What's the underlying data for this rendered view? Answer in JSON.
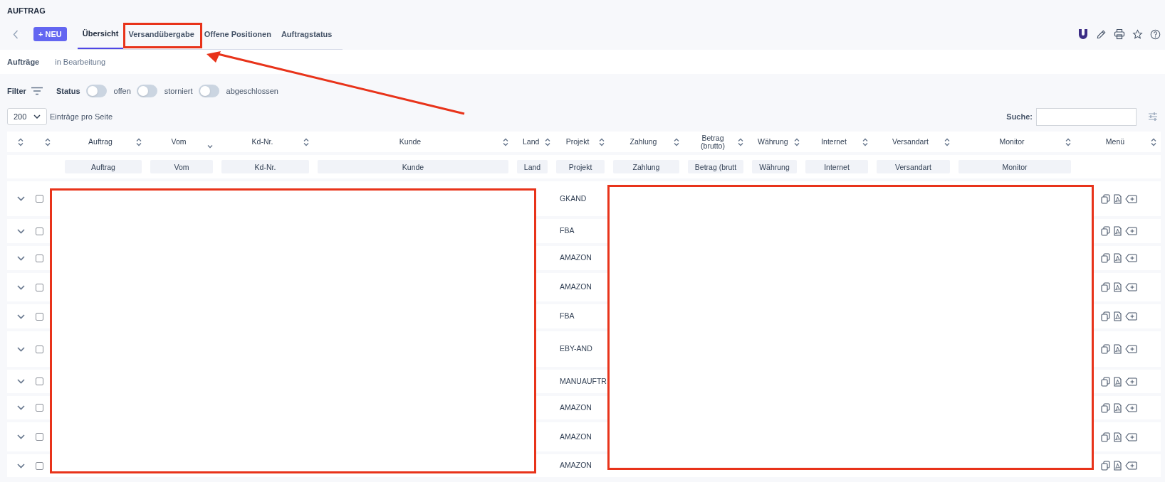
{
  "page_title": "AUFTRAG",
  "new_button": "+ NEU",
  "tabs": [
    {
      "label": "Übersicht",
      "selected": true
    },
    {
      "label": "Versandübergabe",
      "selected": false
    },
    {
      "label": "Offene Positionen",
      "selected": false
    },
    {
      "label": "Auftragstatus",
      "selected": false
    }
  ],
  "subnav": [
    {
      "label": "Aufträge",
      "selected": true
    },
    {
      "label": "in Bearbeitung",
      "selected": false
    }
  ],
  "filter": {
    "label": "Filter",
    "status_label": "Status",
    "toggles": [
      {
        "label": "offen",
        "on": false
      },
      {
        "label": "storniert",
        "on": false
      },
      {
        "label": "abgeschlossen",
        "on": false
      }
    ]
  },
  "page_size": {
    "value": "200",
    "label": "Einträge pro Seite"
  },
  "search": {
    "label": "Suche:"
  },
  "table": {
    "columns": [
      {
        "sorted": false
      },
      {
        "sorted": false
      },
      {
        "label": "Auftrag",
        "sorted": false,
        "filter_placeholder": "Auftrag"
      },
      {
        "label": "Vom",
        "sorted": true,
        "filter_placeholder": "Vom"
      },
      {
        "label": "Kd-Nr.",
        "sorted": false,
        "filter_placeholder": "Kd-Nr."
      },
      {
        "label": "Kunde",
        "sorted": false,
        "filter_placeholder": "Kunde"
      },
      {
        "label": "Land",
        "sorted": false,
        "filter_placeholder": "Land"
      },
      {
        "label": "Projekt",
        "sorted": false,
        "filter_placeholder": "Projekt"
      },
      {
        "label": "Zahlung",
        "sorted": false,
        "filter_placeholder": "Zahlung"
      },
      {
        "label": "Betrag (brutto)",
        "sorted": false,
        "filter_placeholder": "Betrag (brutt"
      },
      {
        "label": "Währung",
        "sorted": false,
        "filter_placeholder": "Währung"
      },
      {
        "label": "Internet",
        "sorted": false,
        "filter_placeholder": "Internet"
      },
      {
        "label": "Versandart",
        "sorted": false,
        "filter_placeholder": "Versandart"
      },
      {
        "label": "Monitor",
        "sorted": false,
        "filter_placeholder": "Monitor"
      },
      {
        "label": "Menü",
        "sorted": false
      }
    ],
    "rows": [
      {
        "checked": false,
        "projekt": "GKAND"
      },
      {
        "checked": false,
        "projekt": "FBA"
      },
      {
        "checked": false,
        "projekt": "AMAZON"
      },
      {
        "checked": false,
        "projekt": "AMAZON"
      },
      {
        "checked": false,
        "projekt": "FBA"
      },
      {
        "checked": false,
        "projekt": "EBY-AND"
      },
      {
        "checked": false,
        "projekt": "MANUAUFTR"
      },
      {
        "checked": false,
        "projekt": "AMAZON"
      },
      {
        "checked": false,
        "projekt": "AMAZON"
      },
      {
        "checked": false,
        "projekt": "AMAZON"
      }
    ]
  }
}
